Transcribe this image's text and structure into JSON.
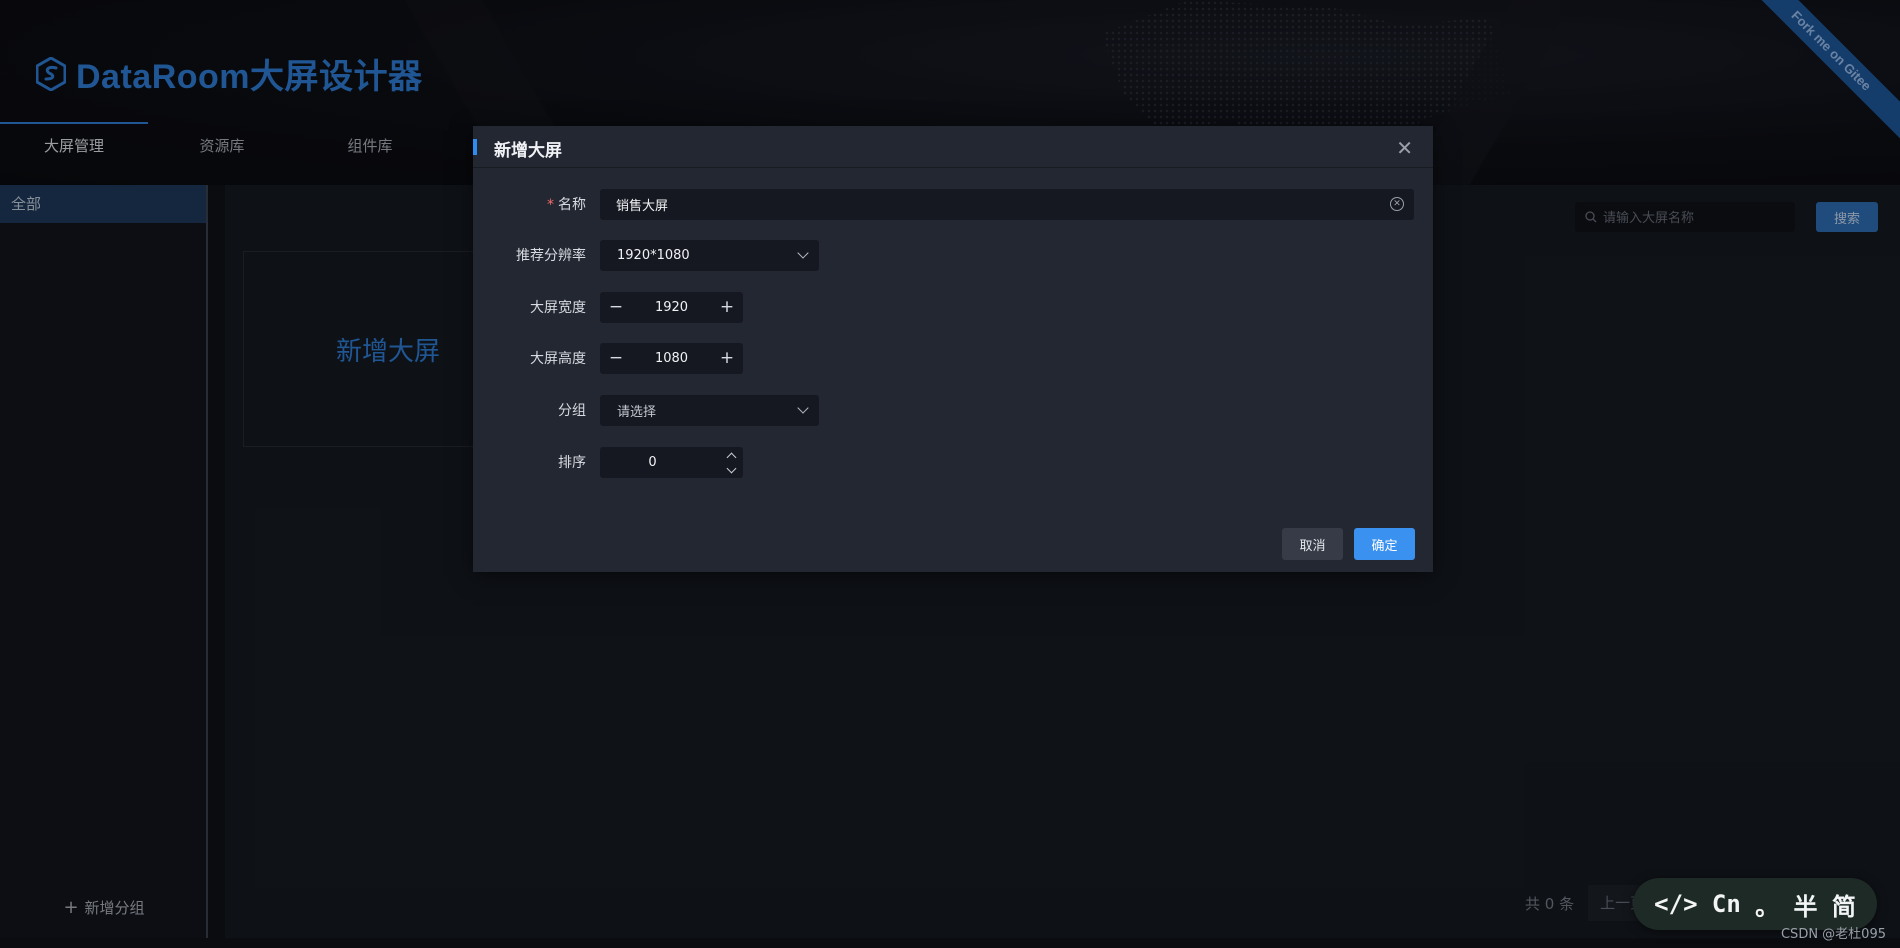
{
  "header": {
    "title": "DataRoom大屏设计器",
    "ribbon": "Fork me on Gitee",
    "nav": [
      {
        "label": "大屏管理",
        "active": true
      },
      {
        "label": "资源库",
        "active": false
      },
      {
        "label": "组件库",
        "active": false
      }
    ]
  },
  "sidebar": {
    "items": [
      {
        "label": "全部",
        "active": true
      }
    ],
    "add_group_label": "新增分组"
  },
  "main": {
    "new_card_label": "新增大屏",
    "search": {
      "placeholder": "请输入大屏名称",
      "button": "搜索"
    },
    "pager": {
      "total": "共 0 条",
      "prev": "上一页"
    }
  },
  "dialog": {
    "title": "新增大屏",
    "fields": {
      "name": {
        "label": "名称",
        "value": "销售大屏",
        "required": true
      },
      "resolution": {
        "label": "推荐分辨率",
        "value": "1920*1080"
      },
      "width": {
        "label": "大屏宽度",
        "value": "1920"
      },
      "height": {
        "label": "大屏高度",
        "value": "1080"
      },
      "group": {
        "label": "分组",
        "placeholder": "请选择"
      },
      "order": {
        "label": "排序",
        "value": "0"
      }
    },
    "cancel": "取消",
    "confirm": "确定"
  },
  "widget": {
    "items": [
      "</>",
      "Cn",
      "。",
      "半",
      "简"
    ]
  },
  "watermark": "CSDN @老杜095",
  "colors": {
    "accent": "#2e7fd9",
    "primary_button": "#3a91f0",
    "required": "#f56c6c"
  },
  "icons": [
    "logo-icon",
    "close-icon",
    "clear-icon",
    "chevron-down-icon",
    "plus-icon",
    "minus-icon",
    "search-icon",
    "arrow-up-icon",
    "arrow-down-icon"
  ]
}
